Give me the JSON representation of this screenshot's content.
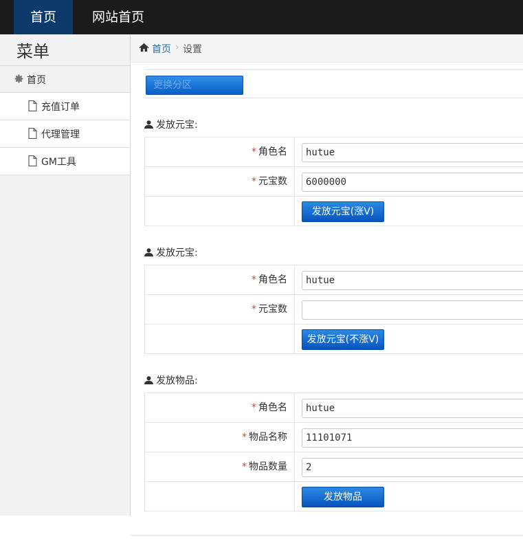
{
  "topnav": {
    "home": "首页",
    "site_home": "网站首页"
  },
  "sidebar": {
    "title": "菜单",
    "root": {
      "label": "首页",
      "icon": "gear-icon"
    },
    "items": [
      {
        "label": "充值订单",
        "icon": "file-icon"
      },
      {
        "label": "代理管理",
        "icon": "file-icon"
      },
      {
        "label": "GM工具",
        "icon": "file-icon"
      }
    ]
  },
  "breadcrumb": {
    "home": "首页",
    "separator": "›",
    "current": "设置"
  },
  "zone": {
    "button": "更换分区"
  },
  "sections": [
    {
      "title": "发放元宝:",
      "rows": [
        {
          "label": "角色名",
          "value": "hutue"
        },
        {
          "label": "元宝数",
          "value": "6000000"
        }
      ],
      "button": "发放元宝(涨V)"
    },
    {
      "title": "发放元宝:",
      "rows": [
        {
          "label": "角色名",
          "value": "hutue"
        },
        {
          "label": "元宝数",
          "value": ""
        }
      ],
      "button": "发放元宝(不涨V)"
    },
    {
      "title": "发放物品:",
      "rows": [
        {
          "label": "角色名",
          "value": "hutue"
        },
        {
          "label": "物品名称",
          "value": "11101071"
        },
        {
          "label": "物品数量",
          "value": "2"
        }
      ],
      "button": "发放物品"
    }
  ],
  "required_mark": "*",
  "colors": {
    "nav_bg": "#1b1b1b",
    "nav_active": "#0d3a6b",
    "link": "#2a6fb0",
    "button": "#0753bd",
    "required": "#e0402c"
  }
}
